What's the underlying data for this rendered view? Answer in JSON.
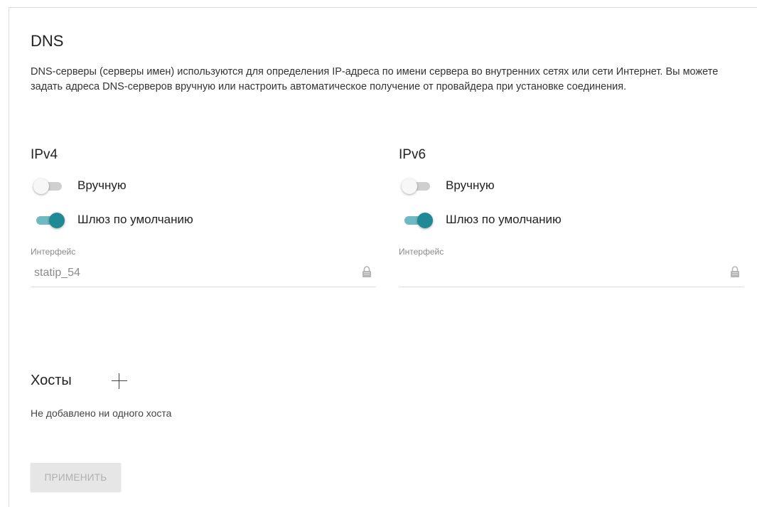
{
  "page": {
    "title": "DNS",
    "description": "DNS-серверы (серверы имен) используются для определения IP-адреса по имени сервера во внутренних сетях или сети Интернет. Вы можете задать адреса DNS-серверов вручную или настроить автоматическое получение от провайдера при установке соединения."
  },
  "ipv4": {
    "title": "IPv4",
    "manual_label": "Вручную",
    "manual_on": false,
    "gateway_label": "Шлюз по умолчанию",
    "gateway_on": true,
    "interface_label": "Интерфейс",
    "interface_value": "statip_54",
    "interface_locked": true
  },
  "ipv6": {
    "title": "IPv6",
    "manual_label": "Вручную",
    "manual_on": false,
    "gateway_label": "Шлюз по умолчанию",
    "gateway_on": true,
    "interface_label": "Интерфейс",
    "interface_value": "",
    "interface_locked": true
  },
  "hosts": {
    "title": "Хосты",
    "add_icon": "plus-icon",
    "empty_text": "Не добавлено ни одного хоста"
  },
  "actions": {
    "apply_label": "ПРИМЕНИТЬ",
    "apply_enabled": false
  },
  "colors": {
    "switch_on_thumb": "#1f8a96",
    "switch_on_track": "#6fb9c2",
    "switch_off_track": "#cfcfcf",
    "muted_text": "#8a8a8a"
  }
}
